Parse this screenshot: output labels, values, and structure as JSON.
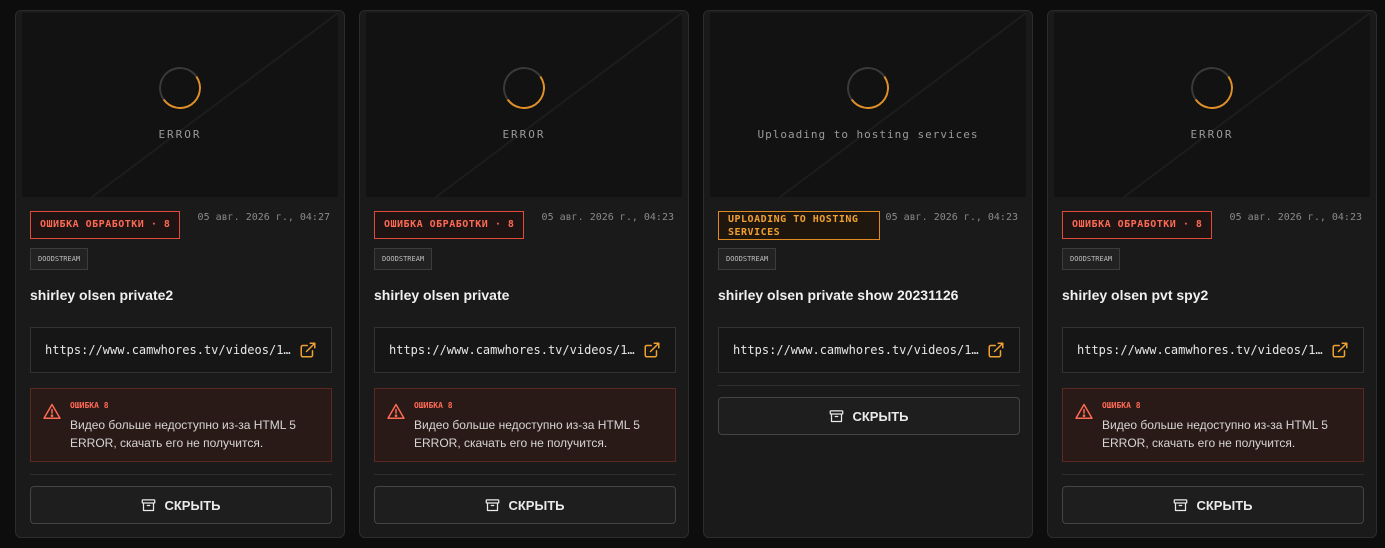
{
  "cards": [
    {
      "thumb_label": "ERROR",
      "status": "ОШИБКА ОБРАБОТКИ · 8",
      "date": "05 авг. 2026 г., 04:27",
      "host": "DOODSTREAM",
      "title": "shirley olsen private2",
      "url": "https://www.camwhores.tv/videos/1…",
      "error_code": "ОШИБКА 8",
      "error_message": "Видео больше недоступно из-за HTML 5 ERROR, скачать его не получится.",
      "hide_label": "СКРЫТЬ"
    },
    {
      "thumb_label": "ERROR",
      "status": "ОШИБКА ОБРАБОТКИ · 8",
      "date": "05 авг. 2026 г., 04:23",
      "host": "DOODSTREAM",
      "title": "shirley olsen private",
      "url": "https://www.camwhores.tv/videos/1…",
      "error_code": "ОШИБКА 8",
      "error_message": "Видео больше недоступно из-за HTML 5 ERROR, скачать его не получится.",
      "hide_label": "СКРЫТЬ"
    },
    {
      "thumb_label": "Uploading to hosting services",
      "status_line1": "UPLOADING TO HOSTING",
      "status_line2": "SERVICES",
      "date": "05 авг. 2026 г., 04:23",
      "host": "DOODSTREAM",
      "title": "shirley olsen private show 20231126",
      "url": "https://www.camwhores.tv/videos/1…",
      "hide_label": "СКРЫТЬ"
    },
    {
      "thumb_label": "ERROR",
      "status": "ОШИБКА ОБРАБОТКИ · 8",
      "date": "05 авг. 2026 г., 04:23",
      "host": "DOODSTREAM",
      "title": "shirley olsen pvt spy2",
      "url": "https://www.camwhores.tv/videos/1…",
      "error_code": "ОШИБКА 8",
      "error_message": "Видео больше недоступно из-за HTML 5 ERROR, скачать его не получится.",
      "hide_label": "СКРЫТЬ"
    }
  ],
  "colors": {
    "error": "#ff6a55",
    "uploading": "#f0a030",
    "background": "#0d0d0d",
    "card": "#1a1a1a"
  },
  "icons": {
    "external_link": "external-link-icon",
    "warning": "warning-triangle-icon",
    "archive": "archive-box-icon",
    "spinner": "loading-spinner-icon"
  }
}
